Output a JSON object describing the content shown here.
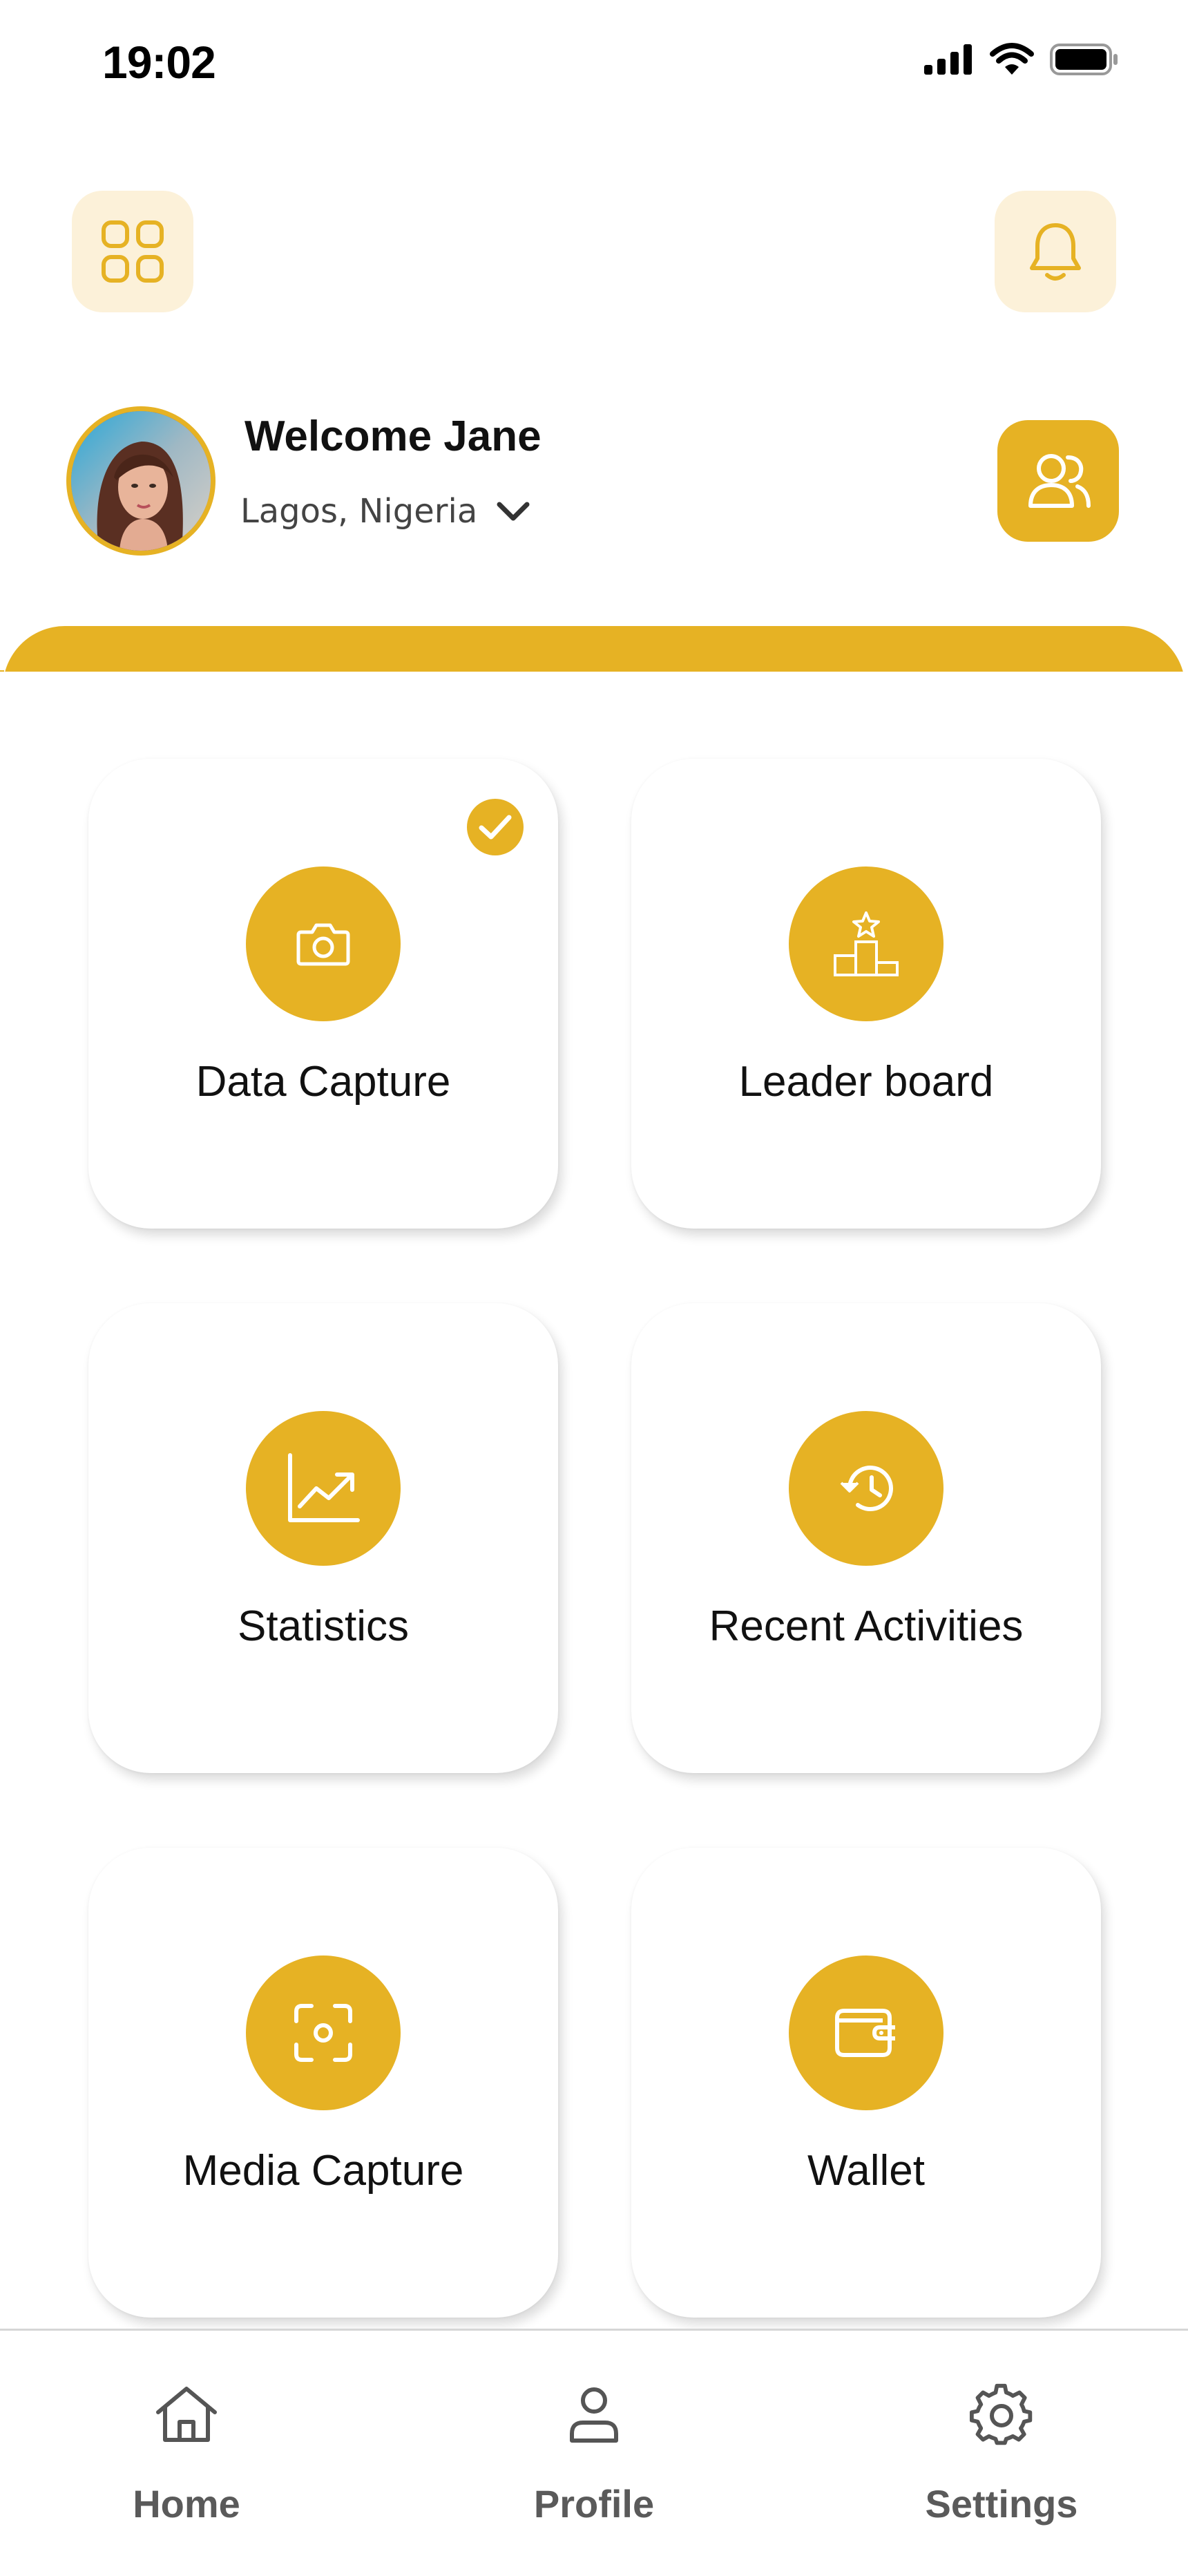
{
  "status_bar": {
    "time": "19:02"
  },
  "header": {
    "welcome": "Welcome Jane",
    "location": "Lagos, Nigeria"
  },
  "colors": {
    "accent": "#E6B224",
    "accent_light": "#FCF1D9"
  },
  "cards": [
    {
      "label": "Data Capture",
      "icon": "camera-icon",
      "checked": true
    },
    {
      "label": "Leader board",
      "icon": "podium-icon",
      "checked": false
    },
    {
      "label": "Statistics",
      "icon": "chart-line-icon",
      "checked": false
    },
    {
      "label": "Recent Activities",
      "icon": "history-icon",
      "checked": false
    },
    {
      "label": "Media Capture",
      "icon": "focus-scan-icon",
      "checked": false
    },
    {
      "label": "Wallet",
      "icon": "wallet-icon",
      "checked": false
    }
  ],
  "nav": [
    {
      "label": "Home",
      "icon": "home-icon"
    },
    {
      "label": "Profile",
      "icon": "user-icon"
    },
    {
      "label": "Settings",
      "icon": "gear-icon"
    }
  ]
}
